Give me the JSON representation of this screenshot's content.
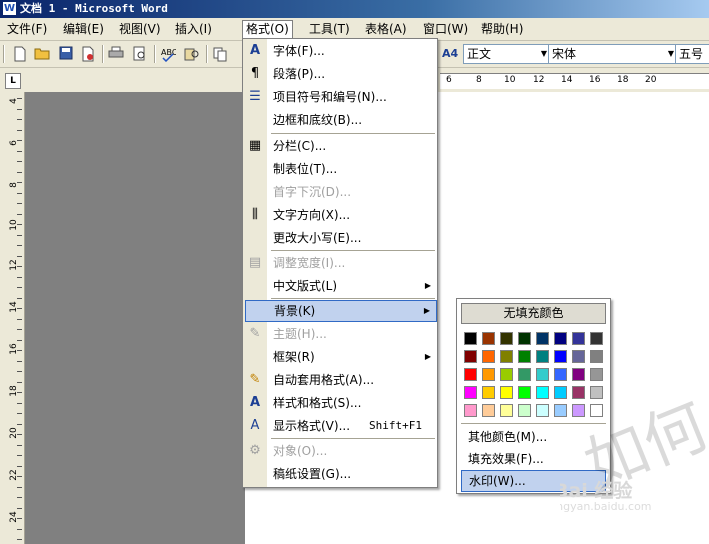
{
  "window": {
    "title": "文档 1 - Microsoft Word",
    "icon": "W"
  },
  "menubar": [
    {
      "label": "文件(F)"
    },
    {
      "label": "编辑(E)"
    },
    {
      "label": "视图(V)"
    },
    {
      "label": "插入(I)"
    },
    {
      "label": "格式(O)",
      "active": true
    },
    {
      "label": "工具(T)"
    },
    {
      "label": "表格(A)"
    },
    {
      "label": "窗口(W)"
    },
    {
      "label": "帮助(H)"
    }
  ],
  "toolbar": {
    "style_value": "正文",
    "font_value": "宋体",
    "size_value": "五号",
    "style_icon": "A4"
  },
  "ruler": {
    "corner_label": "L",
    "numbers": [
      "6",
      "8",
      "10",
      "12",
      "14",
      "16",
      "18",
      "20"
    ]
  },
  "vruler": {
    "numbers": [
      "4",
      "6",
      "8",
      "10",
      "12",
      "14",
      "16",
      "18",
      "20",
      "22",
      "24"
    ]
  },
  "format_menu": {
    "items": [
      {
        "label": "字体(F)...",
        "icon": "A"
      },
      {
        "label": "段落(P)...",
        "icon": "¶"
      },
      {
        "label": "项目符号和编号(N)...",
        "icon": "☰"
      },
      {
        "label": "边框和底纹(B)...",
        "icon": ""
      },
      {
        "label": "分栏(C)...",
        "icon": "▦"
      },
      {
        "label": "制表位(T)...",
        "icon": ""
      },
      {
        "label": "首字下沉(D)...",
        "icon": "",
        "disabled": true
      },
      {
        "label": "文字方向(X)...",
        "icon": "⫼"
      },
      {
        "label": "更改大小写(E)...",
        "icon": ""
      },
      {
        "label": "调整宽度(I)...",
        "icon": "▤",
        "disabled": true
      },
      {
        "label": "中文版式(L)",
        "icon": "",
        "submenu": true
      },
      {
        "label": "背景(K)",
        "icon": "",
        "submenu": true,
        "selected": true
      },
      {
        "label": "主题(H)...",
        "icon": "✎",
        "disabled": true
      },
      {
        "label": "框架(R)",
        "icon": "",
        "submenu": true
      },
      {
        "label": "自动套用格式(A)...",
        "icon": "✎"
      },
      {
        "label": "样式和格式(S)...",
        "icon": "A"
      },
      {
        "label": "显示格式(V)...",
        "icon": "A",
        "shortcut": "Shift+F1"
      },
      {
        "label": "对象(O)...",
        "icon": "⚙",
        "disabled": true
      },
      {
        "label": "稿纸设置(G)...",
        "icon": ""
      }
    ]
  },
  "background_menu": {
    "no_fill": "无填充颜色",
    "colors": [
      [
        "#000000",
        "#993300",
        "#333300",
        "#003300",
        "#003366",
        "#000080",
        "#333399",
        "#333333"
      ],
      [
        "#800000",
        "#FF6600",
        "#808000",
        "#008000",
        "#008080",
        "#0000FF",
        "#666699",
        "#808080"
      ],
      [
        "#FF0000",
        "#FF9900",
        "#99CC00",
        "#339966",
        "#33CCCC",
        "#3366FF",
        "#800080",
        "#969696"
      ],
      [
        "#FF00FF",
        "#FFCC00",
        "#FFFF00",
        "#00FF00",
        "#00FFFF",
        "#00CCFF",
        "#993366",
        "#C0C0C0"
      ],
      [
        "#FF99CC",
        "#FFCC99",
        "#FFFF99",
        "#CCFFCC",
        "#CCFFFF",
        "#99CCFF",
        "#CC99FF",
        "#FFFFFF"
      ]
    ],
    "more_colors": "其他颜色(M)...",
    "fill_effects": "填充效果(F)...",
    "watermark": "水印(W)..."
  },
  "watermark_overlay": {
    "big": "如何",
    "baidu": "Bai 经验",
    "url": "jingyan.baidu.com"
  }
}
